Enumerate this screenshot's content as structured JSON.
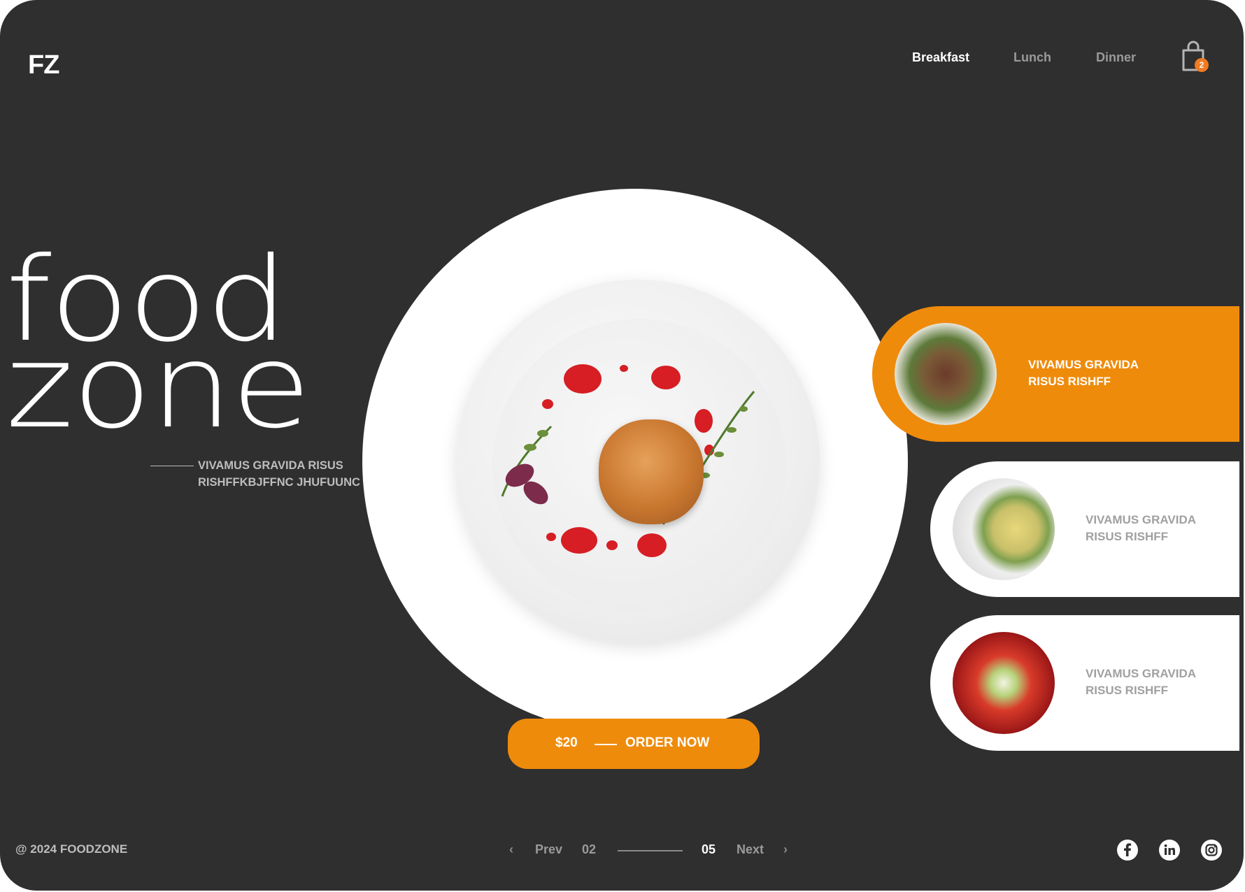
{
  "brand": {
    "logo": "FZ"
  },
  "nav": {
    "items": [
      {
        "label": "Breakfast",
        "active": true
      },
      {
        "label": "Lunch",
        "active": false
      },
      {
        "label": "Dinner",
        "active": false
      }
    ]
  },
  "cart": {
    "count": "2",
    "icon": "shopping-bag-icon"
  },
  "hero": {
    "title_line1": "food",
    "title_line2": "zone",
    "subtitle_line1": "VIVAMUS GRAVIDA RISUS",
    "subtitle_line2": "RISHFFKBJFFNC JHUFUUNC"
  },
  "order": {
    "price": "$20",
    "label": "ORDER NOW"
  },
  "menu_cards": [
    {
      "line1": "VIVAMUS GRAVIDA",
      "line2": "RISUS RISHFF",
      "active": true
    },
    {
      "line1": "VIVAMUS GRAVIDA",
      "line2": "RISUS RISHFF",
      "active": false
    },
    {
      "line1": "VIVAMUS GRAVIDA",
      "line2": "RISUS RISHFF",
      "active": false
    }
  ],
  "footer": {
    "copyright": "@ 2024 FOODZONE"
  },
  "pagination": {
    "prev": "Prev",
    "current": "02",
    "total": "05",
    "next": "Next"
  },
  "social": [
    "facebook-icon",
    "linkedin-icon",
    "instagram-icon"
  ],
  "colors": {
    "background": "#2f2f2f",
    "accent": "#ef8b0b",
    "badge": "#f07b23",
    "card": "#ffffff"
  }
}
